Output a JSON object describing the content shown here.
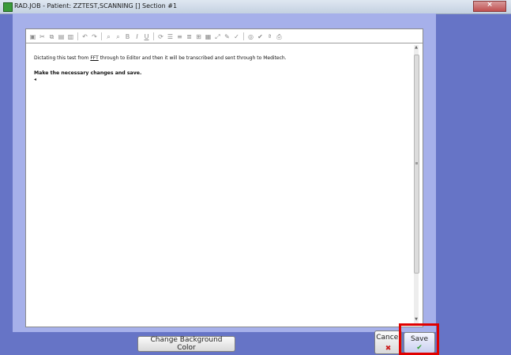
{
  "window": {
    "title": "RAD.JOB - Patient: ZZTEST,SCANNING []   Section #1"
  },
  "toolbar": {
    "icons": [
      "new-icon",
      "cut-icon",
      "copy-icon",
      "paste-icon",
      "paste-special-icon",
      "undo-icon",
      "redo-icon",
      "find-icon",
      "replace-icon",
      "bold-icon",
      "italic-icon",
      "underline-icon",
      "spellcheck-icon",
      "align-left-icon",
      "bullets-icon",
      "numbering-icon",
      "table-icon",
      "insert-icon",
      "zoom-icon",
      "draw-icon",
      "format-icon",
      "binoculars-icon",
      "checkmark-icon",
      "abc-icon",
      "print-icon"
    ]
  },
  "editor": {
    "line1_prefix": "Dictating this test from ",
    "line1_link": "FFT",
    "line1_suffix": " through to Editor and then it will be transcribed and sent through to Meditech.",
    "line2": "Make the necessary changes and save.",
    "caret": "◂"
  },
  "buttons": {
    "change_bg": "Change Background Color",
    "cancel": "Cancel",
    "cancel_glyph": "✖",
    "save": "Save",
    "save_glyph": "✔"
  },
  "colors": {
    "background": "#6674c6",
    "panel": "#a6b0ea",
    "highlight": "#e00000"
  }
}
